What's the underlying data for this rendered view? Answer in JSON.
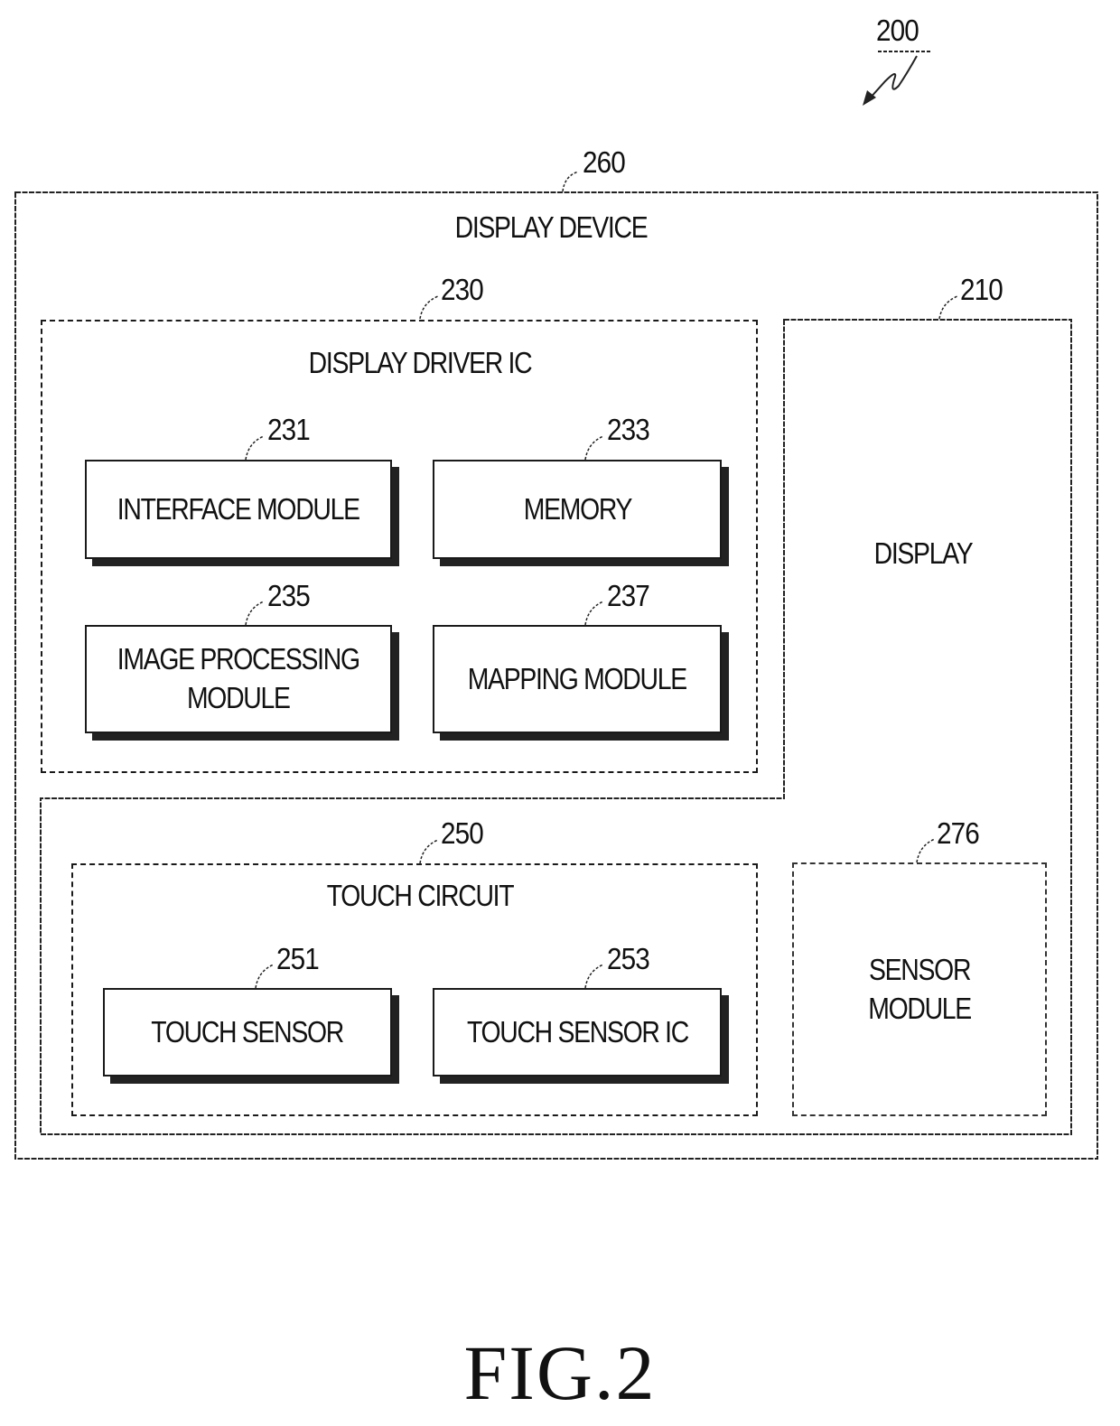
{
  "figure": {
    "number_ref": "200",
    "caption": "FIG.2"
  },
  "display_device": {
    "ref": "260",
    "title": "DISPLAY DEVICE"
  },
  "display_driver_ic": {
    "ref": "230",
    "title": "DISPLAY DRIVER IC",
    "modules": [
      {
        "ref": "231",
        "label": "INTERFACE MODULE"
      },
      {
        "ref": "233",
        "label": "MEMORY"
      },
      {
        "ref": "235",
        "label": "IMAGE PROCESSING\nMODULE"
      },
      {
        "ref": "237",
        "label": "MAPPING MODULE"
      }
    ]
  },
  "display": {
    "ref": "210",
    "title": "DISPLAY"
  },
  "touch_circuit": {
    "ref": "250",
    "title": "TOUCH CIRCUIT",
    "modules": [
      {
        "ref": "251",
        "label": "TOUCH SENSOR"
      },
      {
        "ref": "253",
        "label": "TOUCH SENSOR IC"
      }
    ]
  },
  "sensor_module": {
    "ref": "276",
    "label": "SENSOR\nMODULE",
    "optional": true
  }
}
